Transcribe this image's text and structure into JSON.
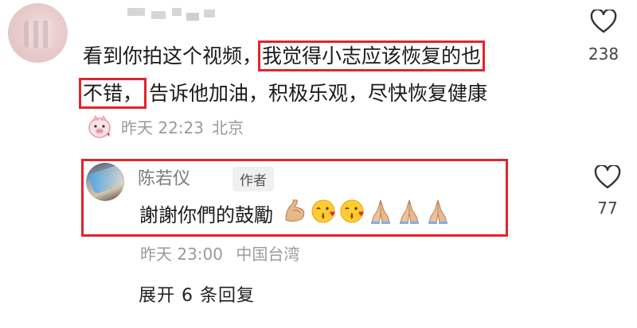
{
  "comment": {
    "body_prefix": "看到你拍这个视频，",
    "body_highlight_1": "我觉得小志应该恢复的也",
    "body_highlight_2": "不错，",
    "body_suffix": "告诉他加油，积极乐观，尽快恢复健康",
    "time": "昨天 22:23",
    "location": "北京",
    "likes": "238"
  },
  "reply": {
    "author": "陈若仪",
    "author_tag": "作者",
    "text": "謝謝你們的鼓勵",
    "emojis": [
      "flexed-biceps",
      "kissing-face",
      "kissing-face",
      "folded-hands",
      "folded-hands",
      "folded-hands"
    ],
    "time": "昨天 23:00",
    "location": "中国台湾",
    "likes": "77"
  },
  "expand_replies": "展开 6 条回复",
  "colors": {
    "highlight": "#e0252b",
    "meta": "#9a9a9a"
  }
}
